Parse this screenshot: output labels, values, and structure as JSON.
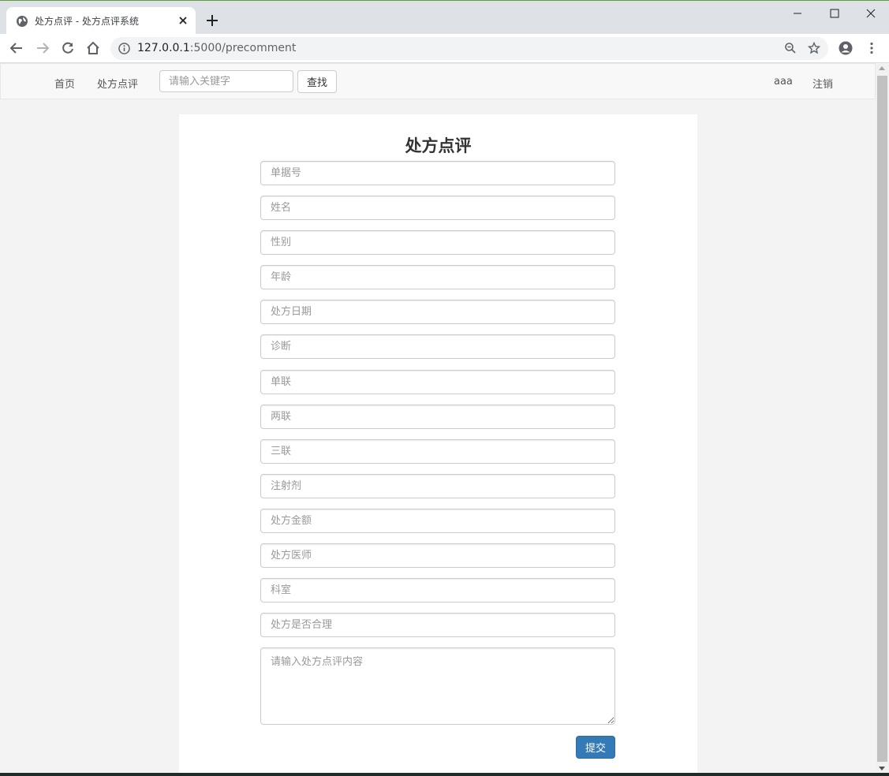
{
  "browser": {
    "tab_title": "处方点评 - 处方点评系统",
    "url_host": "127.0.0.1",
    "url_rest": ":5000/precomment"
  },
  "navbar": {
    "home": "首页",
    "comment": "处方点评",
    "search_placeholder": "请输入关键字",
    "search_button": "查找",
    "user": "aaa",
    "logout": "注销"
  },
  "form": {
    "title": "处方点评",
    "fields": [
      "单据号",
      "姓名",
      "性别",
      "年龄",
      "处方日期",
      "诊断",
      "单联",
      "两联",
      "三联",
      "注射剂",
      "处方金额",
      "处方医师",
      "科室",
      "处方是否合理"
    ],
    "textarea_placeholder": "请输入处方点评内容",
    "submit": "提交"
  },
  "colors": {
    "primary": "#337ab7"
  }
}
